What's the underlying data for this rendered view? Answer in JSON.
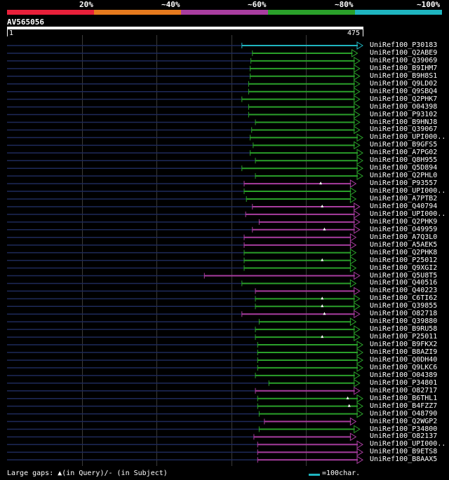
{
  "scale": {
    "labels": [
      "20%",
      "~40%",
      "~60%",
      "~80%",
      "~100%"
    ],
    "colors": [
      "#e8203a",
      "#e57a1e",
      "#a83d9f",
      "#2aa02a",
      "#1fb5c0"
    ]
  },
  "query": {
    "id": "AV565056",
    "start": "1",
    "end": "475",
    "length": 475
  },
  "hits": [
    {
      "name": "UniRef100_P30183",
      "start": 314,
      "end": 475,
      "color": "#1fb5c0",
      "marks": []
    },
    {
      "name": "UniRef100_Q2ABE9",
      "start": 328,
      "end": 468,
      "color": "#2aa02a",
      "marks": []
    },
    {
      "name": "UniRef100_Q39069",
      "start": 326,
      "end": 471,
      "color": "#2aa02a",
      "marks": []
    },
    {
      "name": "UniRef100_B9IHM7",
      "start": 325,
      "end": 471,
      "color": "#2aa02a",
      "marks": []
    },
    {
      "name": "UniRef100_B9H8S1",
      "start": 325,
      "end": 471,
      "color": "#2aa02a",
      "marks": []
    },
    {
      "name": "UniRef100_Q9LD02",
      "start": 323,
      "end": 471,
      "color": "#2aa02a",
      "marks": []
    },
    {
      "name": "UniRef100_Q9SBQ4",
      "start": 323,
      "end": 471,
      "color": "#2aa02a",
      "marks": []
    },
    {
      "name": "UniRef100_Q2PHK7",
      "start": 314,
      "end": 471,
      "color": "#2aa02a",
      "marks": []
    },
    {
      "name": "UniRef100_O04398",
      "start": 323,
      "end": 471,
      "color": "#2aa02a",
      "marks": []
    },
    {
      "name": "UniRef100_P93102",
      "start": 323,
      "end": 471,
      "color": "#2aa02a",
      "marks": []
    },
    {
      "name": "UniRef100_B9HNJ8",
      "start": 332,
      "end": 471,
      "color": "#2aa02a",
      "marks": []
    },
    {
      "name": "UniRef100_Q39067",
      "start": 327,
      "end": 471,
      "color": "#2aa02a",
      "marks": []
    },
    {
      "name": "UniRef100_UPI000..",
      "start": 325,
      "end": 475,
      "color": "#2aa02a",
      "marks": []
    },
    {
      "name": "UniRef100_B9GFS5",
      "start": 329,
      "end": 471,
      "color": "#2aa02a",
      "marks": []
    },
    {
      "name": "UniRef100_A7PG02",
      "start": 325,
      "end": 475,
      "color": "#2aa02a",
      "marks": []
    },
    {
      "name": "UniRef100_Q8H955",
      "start": 332,
      "end": 475,
      "color": "#2aa02a",
      "marks": []
    },
    {
      "name": "UniRef100_Q5D894",
      "start": 314,
      "end": 475,
      "color": "#2aa02a",
      "marks": []
    },
    {
      "name": "UniRef100_Q2PHL0",
      "start": 332,
      "end": 475,
      "color": "#2aa02a",
      "marks": []
    },
    {
      "name": "UniRef100_P93557",
      "start": 317,
      "end": 466,
      "color": "#a83d9f",
      "marks": [
        419
      ]
    },
    {
      "name": "UniRef100_UPI000..",
      "start": 317,
      "end": 466,
      "color": "#2aa02a",
      "marks": []
    },
    {
      "name": "UniRef100_A7PTB2",
      "start": 320,
      "end": 466,
      "color": "#2aa02a",
      "marks": []
    },
    {
      "name": "UniRef100_Q40794",
      "start": 328,
      "end": 471,
      "color": "#a83d9f",
      "marks": [
        421
      ]
    },
    {
      "name": "UniRef100_UPI000..",
      "start": 319,
      "end": 471,
      "color": "#a83d9f",
      "marks": []
    },
    {
      "name": "UniRef100_Q2PHK9",
      "start": 337,
      "end": 471,
      "color": "#a83d9f",
      "marks": []
    },
    {
      "name": "UniRef100_O49959",
      "start": 328,
      "end": 471,
      "color": "#a83d9f",
      "marks": [
        424
      ]
    },
    {
      "name": "UniRef100_A7Q3L0",
      "start": 317,
      "end": 466,
      "color": "#a83d9f",
      "marks": []
    },
    {
      "name": "UniRef100_A5AEK5",
      "start": 317,
      "end": 466,
      "color": "#a83d9f",
      "marks": []
    },
    {
      "name": "UniRef100_Q2PHK8",
      "start": 317,
      "end": 466,
      "color": "#2aa02a",
      "marks": []
    },
    {
      "name": "UniRef100_P25012",
      "start": 317,
      "end": 466,
      "color": "#2aa02a",
      "marks": [
        421
      ]
    },
    {
      "name": "UniRef100_Q9XGI2",
      "start": 317,
      "end": 466,
      "color": "#2aa02a",
      "marks": []
    },
    {
      "name": "UniRef100_Q5U8T5",
      "start": 264,
      "end": 471,
      "color": "#a83d9f",
      "marks": []
    },
    {
      "name": "UniRef100_Q40516",
      "start": 314,
      "end": 466,
      "color": "#2aa02a",
      "marks": []
    },
    {
      "name": "UniRef100_Q40223",
      "start": 332,
      "end": 471,
      "color": "#a83d9f",
      "marks": []
    },
    {
      "name": "UniRef100_C6TI62",
      "start": 332,
      "end": 471,
      "color": "#2aa02a",
      "marks": [
        421
      ]
    },
    {
      "name": "UniRef100_Q39855",
      "start": 332,
      "end": 471,
      "color": "#2aa02a",
      "marks": [
        421
      ]
    },
    {
      "name": "UniRef100_O82718",
      "start": 314,
      "end": 471,
      "color": "#a83d9f",
      "marks": [
        424
      ]
    },
    {
      "name": "UniRef100_Q39880",
      "start": 337,
      "end": 466,
      "color": "#2aa02a",
      "marks": []
    },
    {
      "name": "UniRef100_B9RU58",
      "start": 332,
      "end": 471,
      "color": "#2aa02a",
      "marks": []
    },
    {
      "name": "UniRef100_P25011",
      "start": 332,
      "end": 471,
      "color": "#2aa02a",
      "marks": [
        421
      ]
    },
    {
      "name": "UniRef100_B9FKX2",
      "start": 335,
      "end": 475,
      "color": "#2aa02a",
      "marks": []
    },
    {
      "name": "UniRef100_B8AZI9",
      "start": 335,
      "end": 475,
      "color": "#2aa02a",
      "marks": []
    },
    {
      "name": "UniRef100_Q0DH40",
      "start": 335,
      "end": 475,
      "color": "#2aa02a",
      "marks": []
    },
    {
      "name": "UniRef100_Q9LKC6",
      "start": 335,
      "end": 475,
      "color": "#2aa02a",
      "marks": []
    },
    {
      "name": "UniRef100_O04389",
      "start": 332,
      "end": 471,
      "color": "#2aa02a",
      "marks": []
    },
    {
      "name": "UniRef100_P34801",
      "start": 350,
      "end": 471,
      "color": "#2aa02a",
      "marks": []
    },
    {
      "name": "UniRef100_O82717",
      "start": 332,
      "end": 471,
      "color": "#a83d9f",
      "marks": []
    },
    {
      "name": "UniRef100_B6THL1",
      "start": 335,
      "end": 475,
      "color": "#2aa02a",
      "marks": [
        455
      ]
    },
    {
      "name": "UniRef100_B4FZZ7",
      "start": 335,
      "end": 475,
      "color": "#2aa02a",
      "marks": [
        457
      ]
    },
    {
      "name": "UniRef100_O48790",
      "start": 337,
      "end": 475,
      "color": "#2aa02a",
      "marks": []
    },
    {
      "name": "UniRef100_Q2WGP2",
      "start": 344,
      "end": 466,
      "color": "#a83d9f",
      "marks": []
    },
    {
      "name": "UniRef100_P34800",
      "start": 337,
      "end": 471,
      "color": "#2aa02a",
      "marks": []
    },
    {
      "name": "UniRef100_O82137",
      "start": 330,
      "end": 466,
      "color": "#a83d9f",
      "marks": []
    },
    {
      "name": "UniRef100_UPI000..",
      "start": 335,
      "end": 475,
      "color": "#a83d9f",
      "marks": []
    },
    {
      "name": "UniRef100_B9ETS8",
      "start": 335,
      "end": 475,
      "color": "#a83d9f",
      "marks": []
    },
    {
      "name": "UniRef100_B8AAX5",
      "start": 335,
      "end": 475,
      "color": "#a83d9f",
      "marks": []
    }
  ],
  "legend": {
    "gaps_text": "Large gaps: ▲(in Query)/- (in Subject)",
    "scale_text": "=100char.",
    "scale_color": "#1fb5c0"
  }
}
